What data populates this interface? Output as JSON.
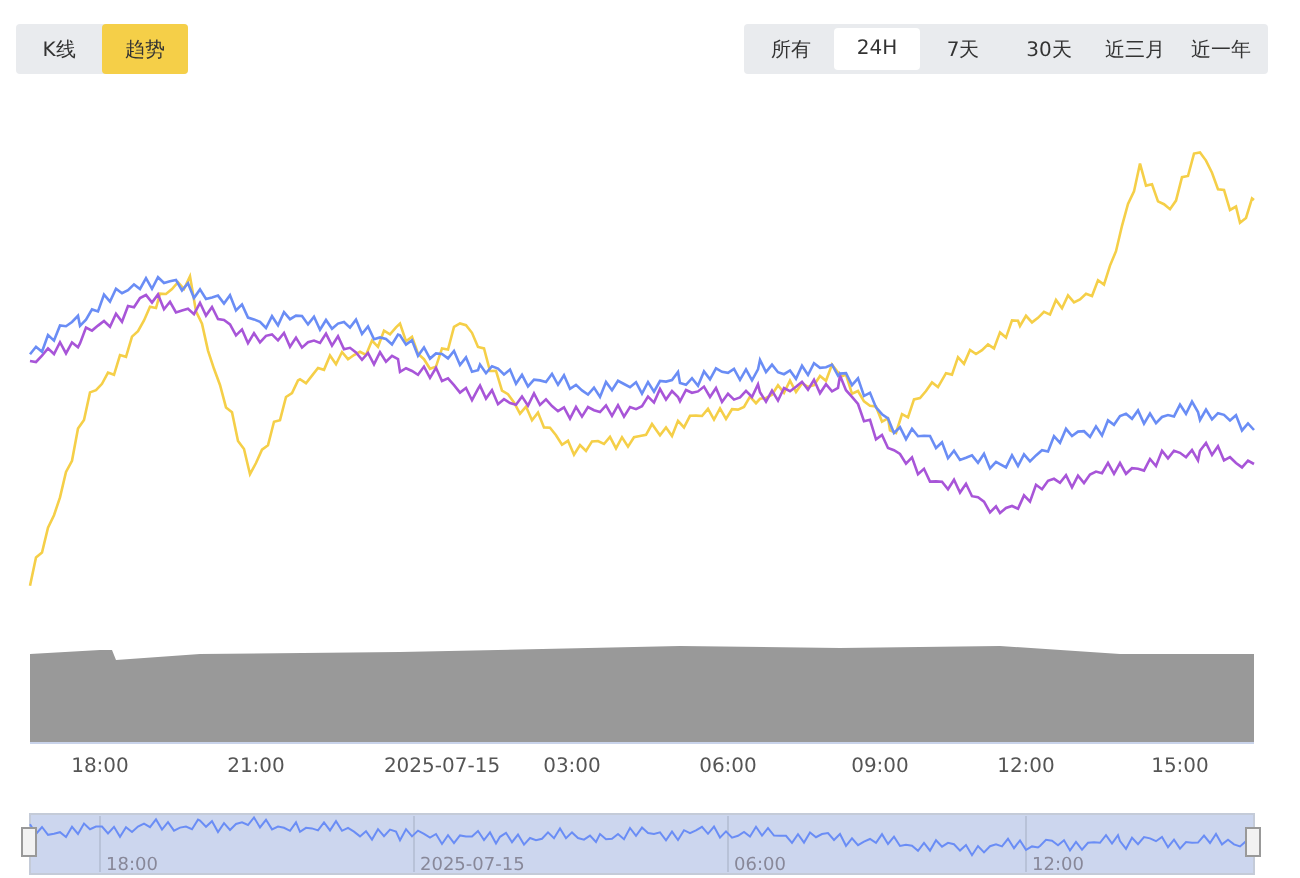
{
  "mode_tabs": [
    {
      "label": "K线",
      "selected": false
    },
    {
      "label": "趋势",
      "selected": true
    }
  ],
  "range_tabs": [
    {
      "label": "所有",
      "selected": false
    },
    {
      "label": "24H",
      "selected": true
    },
    {
      "label": "7天",
      "selected": false
    },
    {
      "label": "30天",
      "selected": false
    },
    {
      "label": "近三月",
      "selected": false
    },
    {
      "label": "近一年",
      "selected": false
    }
  ],
  "x_axis_labels": [
    "18:00",
    "21:00",
    "2025-07-15",
    "03:00",
    "06:00",
    "09:00",
    "12:00",
    "15:00"
  ],
  "navigator_labels": [
    "18:00",
    "2025-07-15",
    "06:00",
    "12:00"
  ]
}
